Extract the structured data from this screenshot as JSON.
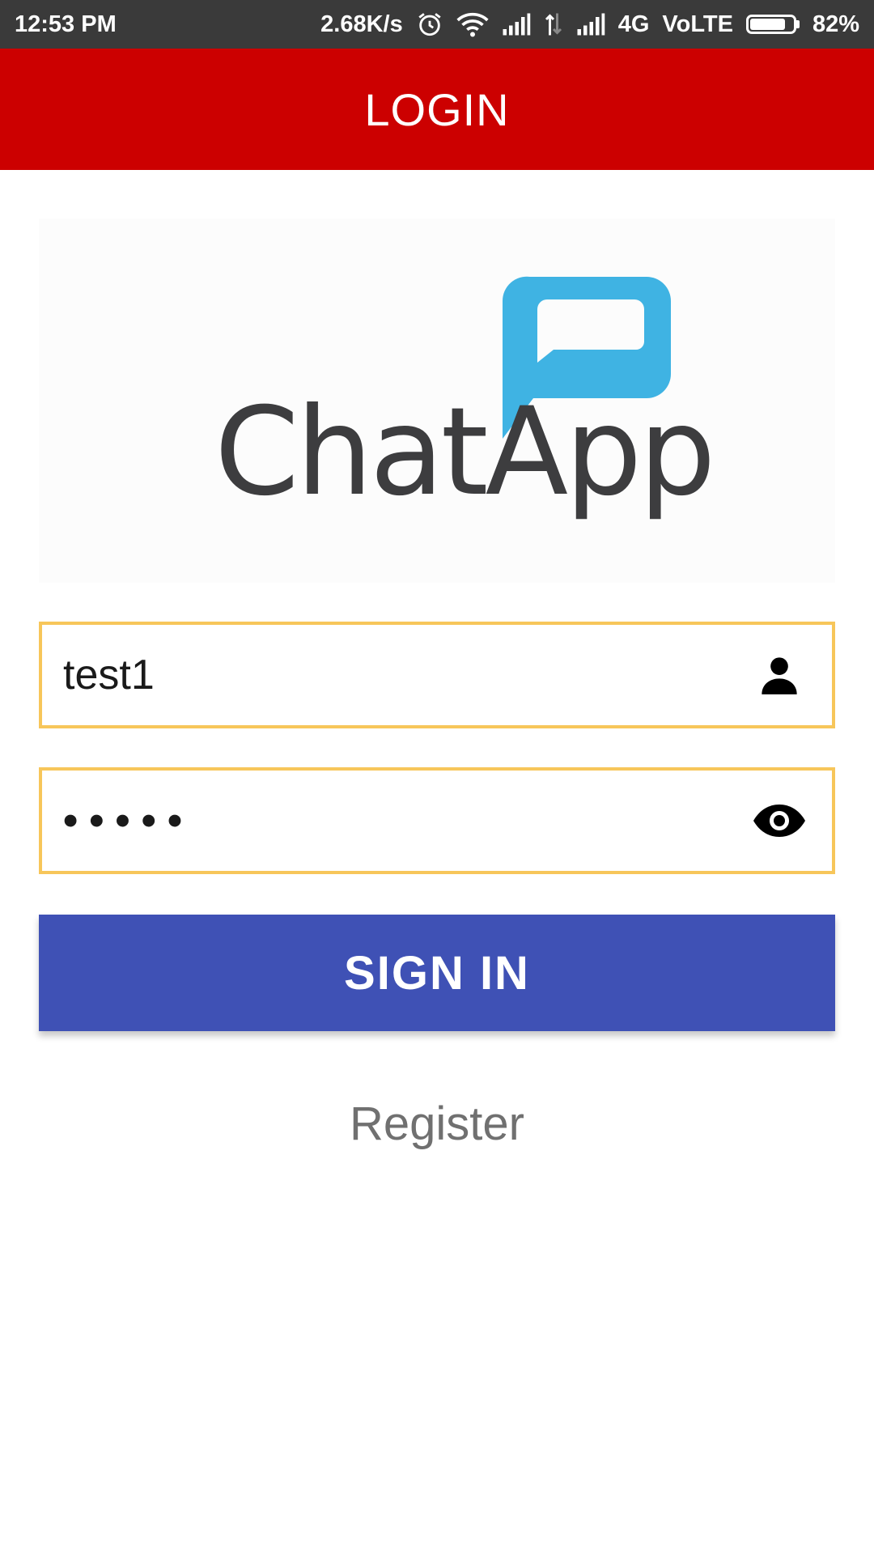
{
  "status_bar": {
    "time": "12:53 PM",
    "net_speed": "2.68K/s",
    "network": "4G",
    "volte": "VoLTE",
    "battery_percent": "82%",
    "battery_level": 0.82,
    "icons": [
      "alarm-icon",
      "wifi-icon",
      "signal-icon",
      "data-arrows-icon",
      "signal-icon",
      "battery-icon"
    ]
  },
  "app_bar": {
    "title": "LOGIN",
    "background": "#cc0000"
  },
  "logo": {
    "text_chat": "Chat",
    "text_app": "App",
    "text_color": "#3d3d3f",
    "bubble_color": "#3fb3e3"
  },
  "form": {
    "username_value": "test1",
    "username_icon": "person-icon",
    "password_masked": "•••••",
    "password_icon": "eye-icon",
    "border_color": "#f7c65a"
  },
  "actions": {
    "sign_in_label": "SIGN IN",
    "sign_in_color": "#3f51b5",
    "register_label": "Register"
  }
}
